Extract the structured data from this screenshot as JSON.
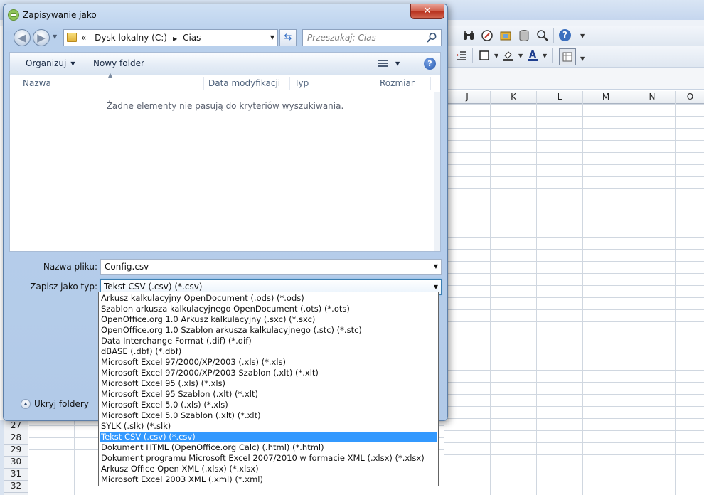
{
  "dialog": {
    "title": "Zapisywanie jako",
    "close_label": "✕",
    "address": {
      "prefix": "«",
      "crumbs": [
        "Dysk lokalny (C:)",
        "Cias"
      ]
    },
    "search": {
      "placeholder": "Przeszukaj: Cias"
    },
    "toolbar": {
      "organize": "Organizuj",
      "new_folder": "Nowy folder"
    },
    "columns": [
      "Nazwa",
      "Data modyfikacji",
      "Typ",
      "Rozmiar"
    ],
    "empty_message": "Żadne elementy nie pasują do kryteriów wyszukiwania.",
    "filename_label": "Nazwa pliku:",
    "filename_value": "Config.csv",
    "filetype_label": "Zapisz jako typ:",
    "filetype_value": "Tekst CSV (.csv) (*.csv)",
    "hide_folders": "Ukryj foldery",
    "filetype_options": [
      "Arkusz kalkulacyjny OpenDocument (.ods) (*.ods)",
      "Szablon arkusza kalkulacyjnego OpenDocument (.ots) (*.ots)",
      "OpenOffice.org 1.0 Arkusz kalkulacyjny (.sxc) (*.sxc)",
      "OpenOffice.org 1.0 Szablon arkusza kalkulacyjnego (.stc) (*.stc)",
      "Data Interchange Format (.dif) (*.dif)",
      "dBASE (.dbf) (*.dbf)",
      "Microsoft Excel 97/2000/XP/2003 (.xls) (*.xls)",
      "Microsoft Excel 97/2000/XP/2003 Szablon (.xlt) (*.xlt)",
      "Microsoft Excel 95 (.xls) (*.xls)",
      "Microsoft Excel 95 Szablon (.xlt) (*.xlt)",
      "Microsoft Excel 5.0 (.xls) (*.xls)",
      "Microsoft Excel 5.0 Szablon (.xlt) (*.xlt)",
      "SYLK (.slk) (*.slk)",
      "Tekst CSV (.csv) (*.csv)",
      "Dokument HTML (OpenOffice.org Calc) (.html) (*.html)",
      "Dokument programu Microsoft Excel 2007/2010 w formacie XML (.xlsx) (*.xlsx)",
      "Arkusz Office Open XML (.xlsx) (*.xlsx)",
      "Microsoft Excel 2003 XML (.xml) (*.xml)"
    ],
    "selected_option_index": 13
  },
  "spreadsheet": {
    "columns": [
      "J",
      "K",
      "L",
      "M",
      "N",
      "O"
    ],
    "rows": [
      "27",
      "28",
      "29",
      "30",
      "31",
      "32"
    ]
  },
  "icons": [
    "binoculars-icon",
    "navigator-icon",
    "gallery-icon",
    "database-icon",
    "zoom-icon",
    "help-icon",
    "border-icon",
    "background-color-icon",
    "font-color-icon",
    "grid-toggle-icon",
    "indent-icon"
  ],
  "colors": {
    "selection": "#3399ff",
    "close_button": "#c7412c",
    "dialog_frame": "#b9d0ec"
  }
}
